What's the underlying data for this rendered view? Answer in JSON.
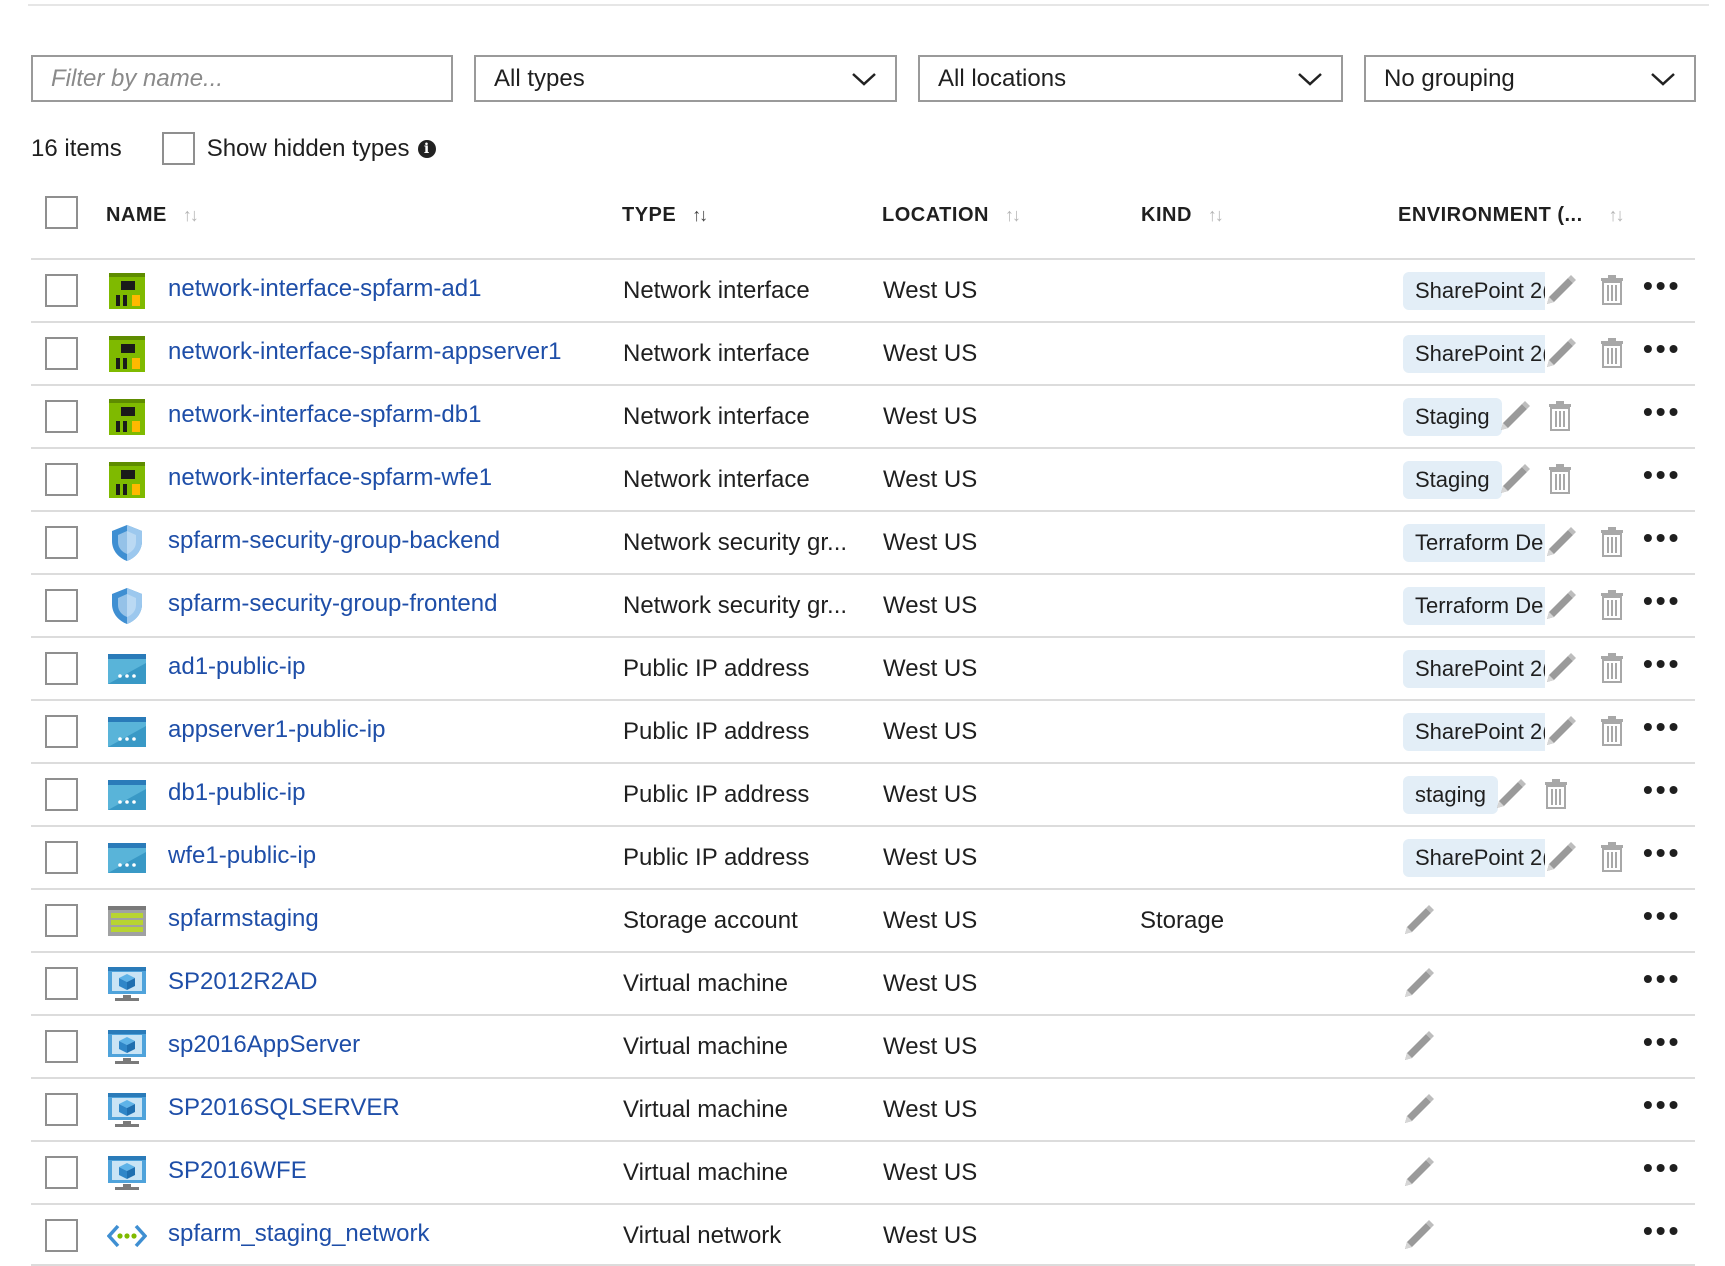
{
  "filters": {
    "name_placeholder": "Filter by name...",
    "type_value": "All types",
    "location_value": "All locations",
    "grouping_value": "No grouping"
  },
  "summary": {
    "count": "16 items",
    "show_hidden_label": "Show hidden types"
  },
  "columns": {
    "name": "NAME",
    "type": "TYPE",
    "location": "LOCATION",
    "kind": "KIND",
    "environment": "ENVIRONMENT (..."
  },
  "sort_glyph": "↑↓",
  "more_glyph": "•••",
  "rows": [
    {
      "name": "network-interface-spfarm-ad1",
      "icon": "network-interface-icon",
      "type": "Network interface",
      "location": "West US",
      "kind": "",
      "environment": "SharePoint 2("
    },
    {
      "name": "network-interface-spfarm-appserver1",
      "icon": "network-interface-icon",
      "type": "Network interface",
      "location": "West US",
      "kind": "",
      "environment": "SharePoint 2("
    },
    {
      "name": "network-interface-spfarm-db1",
      "icon": "network-interface-icon",
      "type": "Network interface",
      "location": "West US",
      "kind": "",
      "environment": "Staging"
    },
    {
      "name": "network-interface-spfarm-wfe1",
      "icon": "network-interface-icon",
      "type": "Network interface",
      "location": "West US",
      "kind": "",
      "environment": "Staging"
    },
    {
      "name": "spfarm-security-group-backend",
      "icon": "shield-icon",
      "type": "Network security gr...",
      "location": "West US",
      "kind": "",
      "environment": "Terraform De"
    },
    {
      "name": "spfarm-security-group-frontend",
      "icon": "shield-icon",
      "type": "Network security gr...",
      "location": "West US",
      "kind": "",
      "environment": "Terraform De"
    },
    {
      "name": "ad1-public-ip",
      "icon": "public-ip-icon",
      "type": "Public IP address",
      "location": "West US",
      "kind": "",
      "environment": "SharePoint 2("
    },
    {
      "name": "appserver1-public-ip",
      "icon": "public-ip-icon",
      "type": "Public IP address",
      "location": "West US",
      "kind": "",
      "environment": "SharePoint 2("
    },
    {
      "name": "db1-public-ip",
      "icon": "public-ip-icon",
      "type": "Public IP address",
      "location": "West US",
      "kind": "",
      "environment": "staging"
    },
    {
      "name": "wfe1-public-ip",
      "icon": "public-ip-icon",
      "type": "Public IP address",
      "location": "West US",
      "kind": "",
      "environment": "SharePoint 2("
    },
    {
      "name": "spfarmstaging",
      "icon": "storage-account-icon",
      "type": "Storage account",
      "location": "West US",
      "kind": "Storage",
      "environment": ""
    },
    {
      "name": "SP2012R2AD",
      "icon": "virtual-machine-icon",
      "type": "Virtual machine",
      "location": "West US",
      "kind": "",
      "environment": ""
    },
    {
      "name": "sp2016AppServer",
      "icon": "virtual-machine-icon",
      "type": "Virtual machine",
      "location": "West US",
      "kind": "",
      "environment": ""
    },
    {
      "name": "SP2016SQLSERVER",
      "icon": "virtual-machine-icon",
      "type": "Virtual machine",
      "location": "West US",
      "kind": "",
      "environment": ""
    },
    {
      "name": "SP2016WFE",
      "icon": "virtual-machine-icon",
      "type": "Virtual machine",
      "location": "West US",
      "kind": "",
      "environment": ""
    },
    {
      "name": "spfarm_staging_network",
      "icon": "virtual-network-icon",
      "type": "Virtual network",
      "location": "West US",
      "kind": "",
      "environment": ""
    }
  ]
}
